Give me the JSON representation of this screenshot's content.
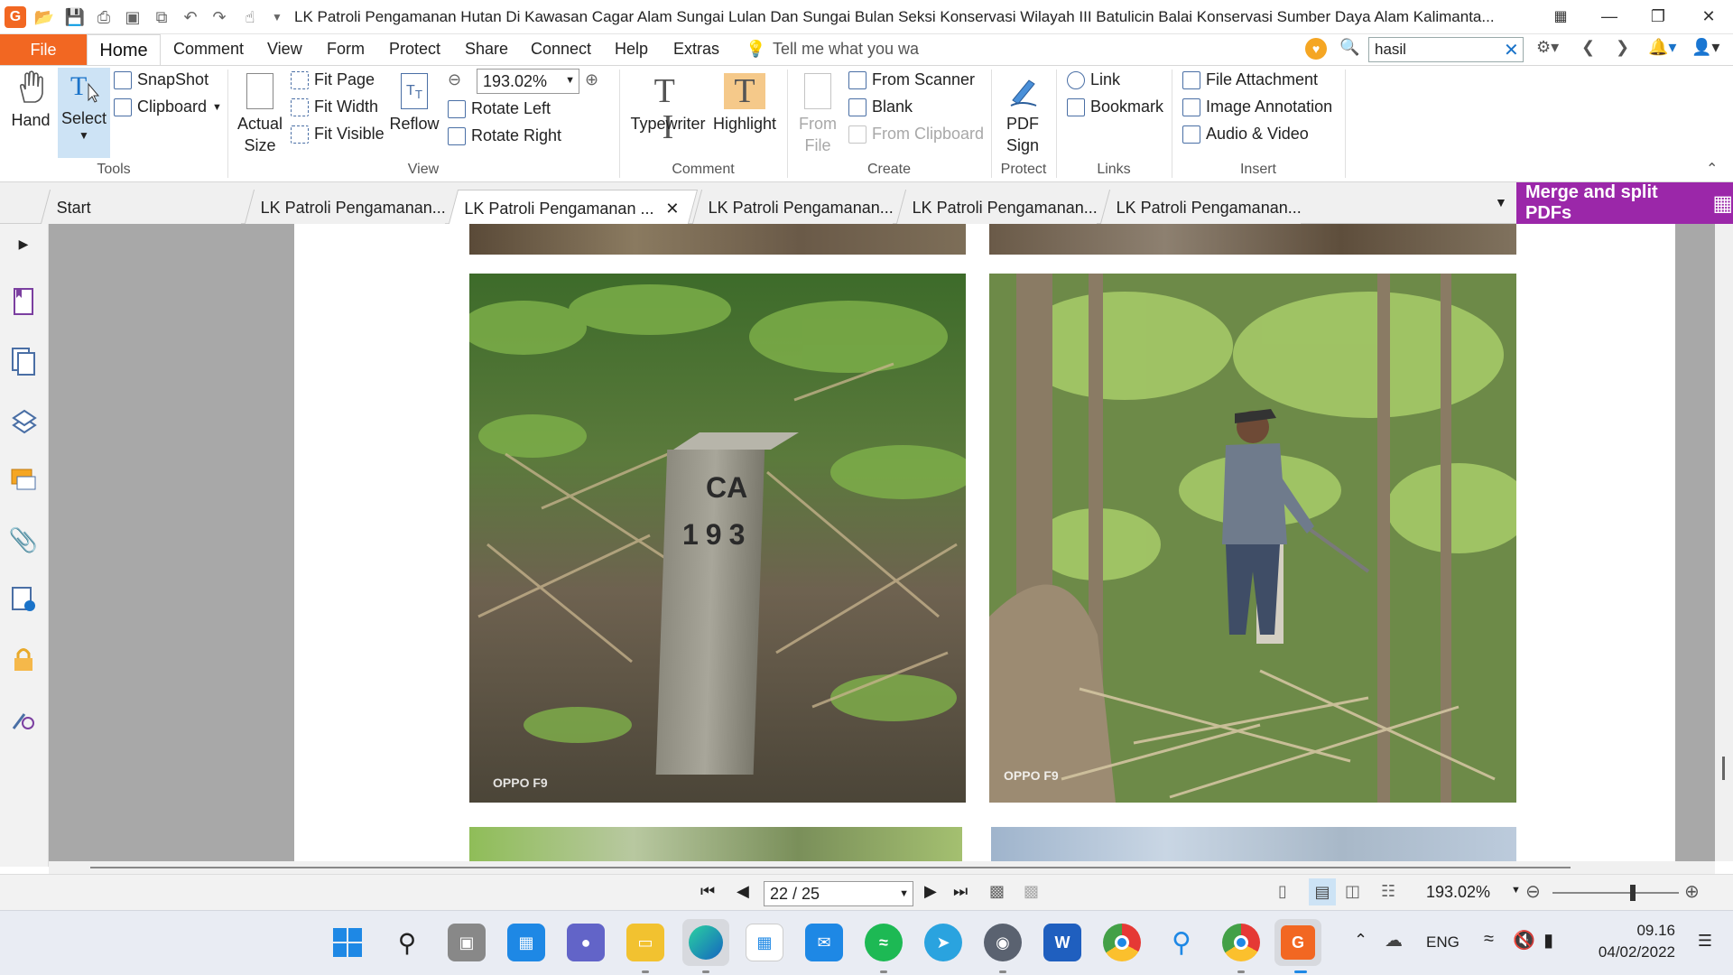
{
  "window": {
    "title": "LK Patroli Pengamanan Hutan Di Kawasan Cagar Alam Sungai Lulan Dan Sungai Bulan Seksi Konservasi Wilayah III Batulicin Balai Konservasi Sumber Daya Alam Kalimanta..."
  },
  "menu": {
    "file": "File",
    "home": "Home",
    "comment": "Comment",
    "view": "View",
    "form": "Form",
    "protect": "Protect",
    "share": "Share",
    "connect": "Connect",
    "help": "Help",
    "extras": "Extras",
    "tell_me": "Tell me what you wa"
  },
  "search": {
    "value": "hasil"
  },
  "ribbon": {
    "tools": {
      "label": "Tools",
      "hand": "Hand",
      "select": "Select",
      "snapshot": "SnapShot",
      "clipboard": "Clipboard"
    },
    "view": {
      "label": "View",
      "actual_size_1": "Actual",
      "actual_size_2": "Size",
      "fit_page": "Fit Page",
      "fit_width": "Fit Width",
      "fit_visible": "Fit Visible",
      "reflow": "Reflow",
      "zoom": "193.02%",
      "rotate_left": "Rotate Left",
      "rotate_right": "Rotate Right"
    },
    "comment": {
      "label": "Comment",
      "typewriter": "Typewriter",
      "highlight": "Highlight"
    },
    "create": {
      "label": "Create",
      "from_file_1": "From",
      "from_file_2": "File",
      "from_scanner": "From Scanner",
      "blank": "Blank",
      "from_clipboard": "From Clipboard"
    },
    "protect": {
      "label": "Protect",
      "pdf_sign_1": "PDF",
      "pdf_sign_2": "Sign"
    },
    "links": {
      "label": "Links",
      "link": "Link",
      "bookmark": "Bookmark"
    },
    "insert": {
      "label": "Insert",
      "file_attachment": "File Attachment",
      "image_annotation": "Image Annotation",
      "audio_video": "Audio & Video"
    }
  },
  "tabs": [
    "Start",
    "LK Patroli Pengamanan...",
    "LK Patroli Pengamanan ...",
    "LK Patroli Pengamanan...",
    "LK Patroli Pengamanan...",
    "LK Patroli Pengamanan..."
  ],
  "merge_button": "Merge and split PDFs",
  "document": {
    "photo1_marker_top": "CA",
    "photo1_marker_num": "193",
    "photo_watermark": "OPPO F9"
  },
  "status": {
    "page_value": "22 / 25",
    "zoom": "193.02%"
  },
  "taskbar": {
    "language": "ENG",
    "time": "09.16",
    "date": "04/02/2022"
  },
  "colors": {
    "accent": "#f26722",
    "merge": "#9b27a9"
  }
}
